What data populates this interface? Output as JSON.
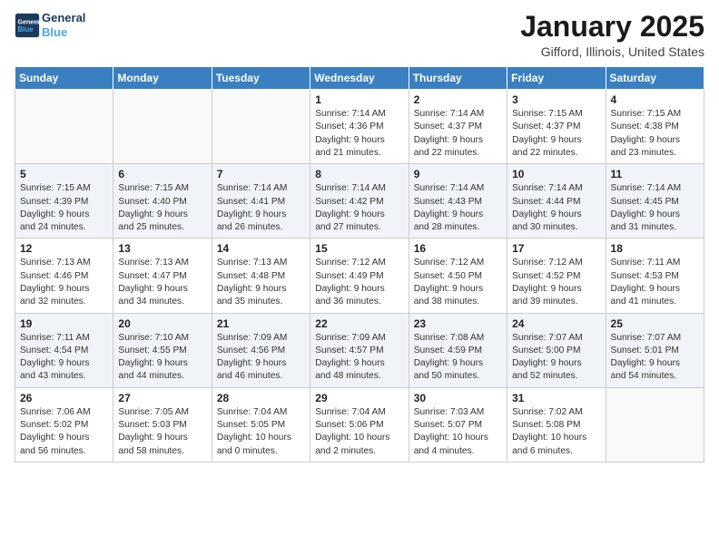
{
  "header": {
    "logo_line1": "General",
    "logo_line2": "Blue",
    "title": "January 2025",
    "subtitle": "Gifford, Illinois, United States"
  },
  "days_of_week": [
    "Sunday",
    "Monday",
    "Tuesday",
    "Wednesday",
    "Thursday",
    "Friday",
    "Saturday"
  ],
  "weeks": [
    [
      {
        "day": "",
        "info": ""
      },
      {
        "day": "",
        "info": ""
      },
      {
        "day": "",
        "info": ""
      },
      {
        "day": "1",
        "info": "Sunrise: 7:14 AM\nSunset: 4:36 PM\nDaylight: 9 hours\nand 21 minutes."
      },
      {
        "day": "2",
        "info": "Sunrise: 7:14 AM\nSunset: 4:37 PM\nDaylight: 9 hours\nand 22 minutes."
      },
      {
        "day": "3",
        "info": "Sunrise: 7:15 AM\nSunset: 4:37 PM\nDaylight: 9 hours\nand 22 minutes."
      },
      {
        "day": "4",
        "info": "Sunrise: 7:15 AM\nSunset: 4:38 PM\nDaylight: 9 hours\nand 23 minutes."
      }
    ],
    [
      {
        "day": "5",
        "info": "Sunrise: 7:15 AM\nSunset: 4:39 PM\nDaylight: 9 hours\nand 24 minutes."
      },
      {
        "day": "6",
        "info": "Sunrise: 7:15 AM\nSunset: 4:40 PM\nDaylight: 9 hours\nand 25 minutes."
      },
      {
        "day": "7",
        "info": "Sunrise: 7:14 AM\nSunset: 4:41 PM\nDaylight: 9 hours\nand 26 minutes."
      },
      {
        "day": "8",
        "info": "Sunrise: 7:14 AM\nSunset: 4:42 PM\nDaylight: 9 hours\nand 27 minutes."
      },
      {
        "day": "9",
        "info": "Sunrise: 7:14 AM\nSunset: 4:43 PM\nDaylight: 9 hours\nand 28 minutes."
      },
      {
        "day": "10",
        "info": "Sunrise: 7:14 AM\nSunset: 4:44 PM\nDaylight: 9 hours\nand 30 minutes."
      },
      {
        "day": "11",
        "info": "Sunrise: 7:14 AM\nSunset: 4:45 PM\nDaylight: 9 hours\nand 31 minutes."
      }
    ],
    [
      {
        "day": "12",
        "info": "Sunrise: 7:13 AM\nSunset: 4:46 PM\nDaylight: 9 hours\nand 32 minutes."
      },
      {
        "day": "13",
        "info": "Sunrise: 7:13 AM\nSunset: 4:47 PM\nDaylight: 9 hours\nand 34 minutes."
      },
      {
        "day": "14",
        "info": "Sunrise: 7:13 AM\nSunset: 4:48 PM\nDaylight: 9 hours\nand 35 minutes."
      },
      {
        "day": "15",
        "info": "Sunrise: 7:12 AM\nSunset: 4:49 PM\nDaylight: 9 hours\nand 36 minutes."
      },
      {
        "day": "16",
        "info": "Sunrise: 7:12 AM\nSunset: 4:50 PM\nDaylight: 9 hours\nand 38 minutes."
      },
      {
        "day": "17",
        "info": "Sunrise: 7:12 AM\nSunset: 4:52 PM\nDaylight: 9 hours\nand 39 minutes."
      },
      {
        "day": "18",
        "info": "Sunrise: 7:11 AM\nSunset: 4:53 PM\nDaylight: 9 hours\nand 41 minutes."
      }
    ],
    [
      {
        "day": "19",
        "info": "Sunrise: 7:11 AM\nSunset: 4:54 PM\nDaylight: 9 hours\nand 43 minutes."
      },
      {
        "day": "20",
        "info": "Sunrise: 7:10 AM\nSunset: 4:55 PM\nDaylight: 9 hours\nand 44 minutes."
      },
      {
        "day": "21",
        "info": "Sunrise: 7:09 AM\nSunset: 4:56 PM\nDaylight: 9 hours\nand 46 minutes."
      },
      {
        "day": "22",
        "info": "Sunrise: 7:09 AM\nSunset: 4:57 PM\nDaylight: 9 hours\nand 48 minutes."
      },
      {
        "day": "23",
        "info": "Sunrise: 7:08 AM\nSunset: 4:59 PM\nDaylight: 9 hours\nand 50 minutes."
      },
      {
        "day": "24",
        "info": "Sunrise: 7:07 AM\nSunset: 5:00 PM\nDaylight: 9 hours\nand 52 minutes."
      },
      {
        "day": "25",
        "info": "Sunrise: 7:07 AM\nSunset: 5:01 PM\nDaylight: 9 hours\nand 54 minutes."
      }
    ],
    [
      {
        "day": "26",
        "info": "Sunrise: 7:06 AM\nSunset: 5:02 PM\nDaylight: 9 hours\nand 56 minutes."
      },
      {
        "day": "27",
        "info": "Sunrise: 7:05 AM\nSunset: 5:03 PM\nDaylight: 9 hours\nand 58 minutes."
      },
      {
        "day": "28",
        "info": "Sunrise: 7:04 AM\nSunset: 5:05 PM\nDaylight: 10 hours\nand 0 minutes."
      },
      {
        "day": "29",
        "info": "Sunrise: 7:04 AM\nSunset: 5:06 PM\nDaylight: 10 hours\nand 2 minutes."
      },
      {
        "day": "30",
        "info": "Sunrise: 7:03 AM\nSunset: 5:07 PM\nDaylight: 10 hours\nand 4 minutes."
      },
      {
        "day": "31",
        "info": "Sunrise: 7:02 AM\nSunset: 5:08 PM\nDaylight: 10 hours\nand 6 minutes."
      },
      {
        "day": "",
        "info": ""
      }
    ]
  ]
}
